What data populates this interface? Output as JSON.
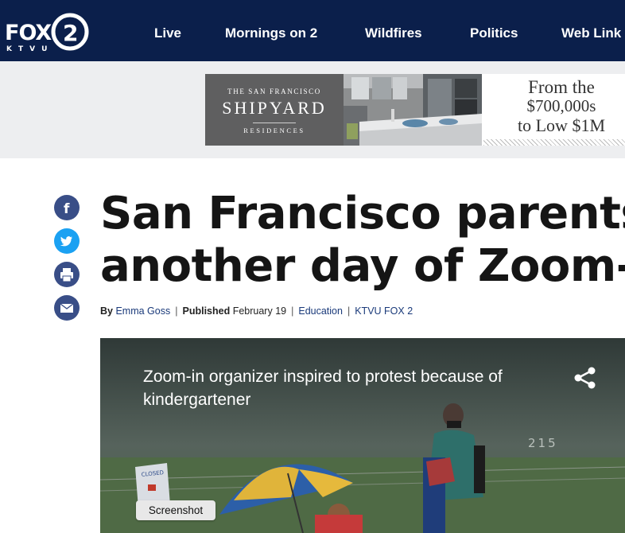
{
  "site": {
    "logo_text": "FOX 2 KTVU"
  },
  "nav": {
    "items": [
      {
        "label": "Live"
      },
      {
        "label": "Mornings on 2"
      },
      {
        "label": "Wildfires"
      },
      {
        "label": "Politics"
      },
      {
        "label": "Web Link"
      }
    ]
  },
  "ad": {
    "brand_line1": "THE SAN FRANCISCO",
    "brand_line2": "SHIPYARD",
    "brand_line3": "RESIDENCES",
    "price_line1": "From the",
    "price_line2": "$700,000s",
    "price_line3": "to Low $1M"
  },
  "share": {
    "icons": [
      "facebook-icon",
      "twitter-icon",
      "print-icon",
      "email-icon"
    ]
  },
  "article": {
    "headline_line1": "San Francisco parents",
    "headline_line2": "another day of Zoom-i",
    "by_label": "By",
    "author": "Emma Goss",
    "published_label": "Published",
    "date": "February 19",
    "category": "Education",
    "source": "KTVU FOX 2"
  },
  "video": {
    "title": "Zoom-in organizer inspired to protest because of kindergartener",
    "sign_text": "CLOSED",
    "field_number": "215"
  },
  "tooltip": {
    "label": "Screenshot"
  },
  "colors": {
    "nav_bg": "#0b1f4b",
    "facebook": "#394e87",
    "twitter": "#1ba1f2",
    "link": "#1a3a7a"
  }
}
